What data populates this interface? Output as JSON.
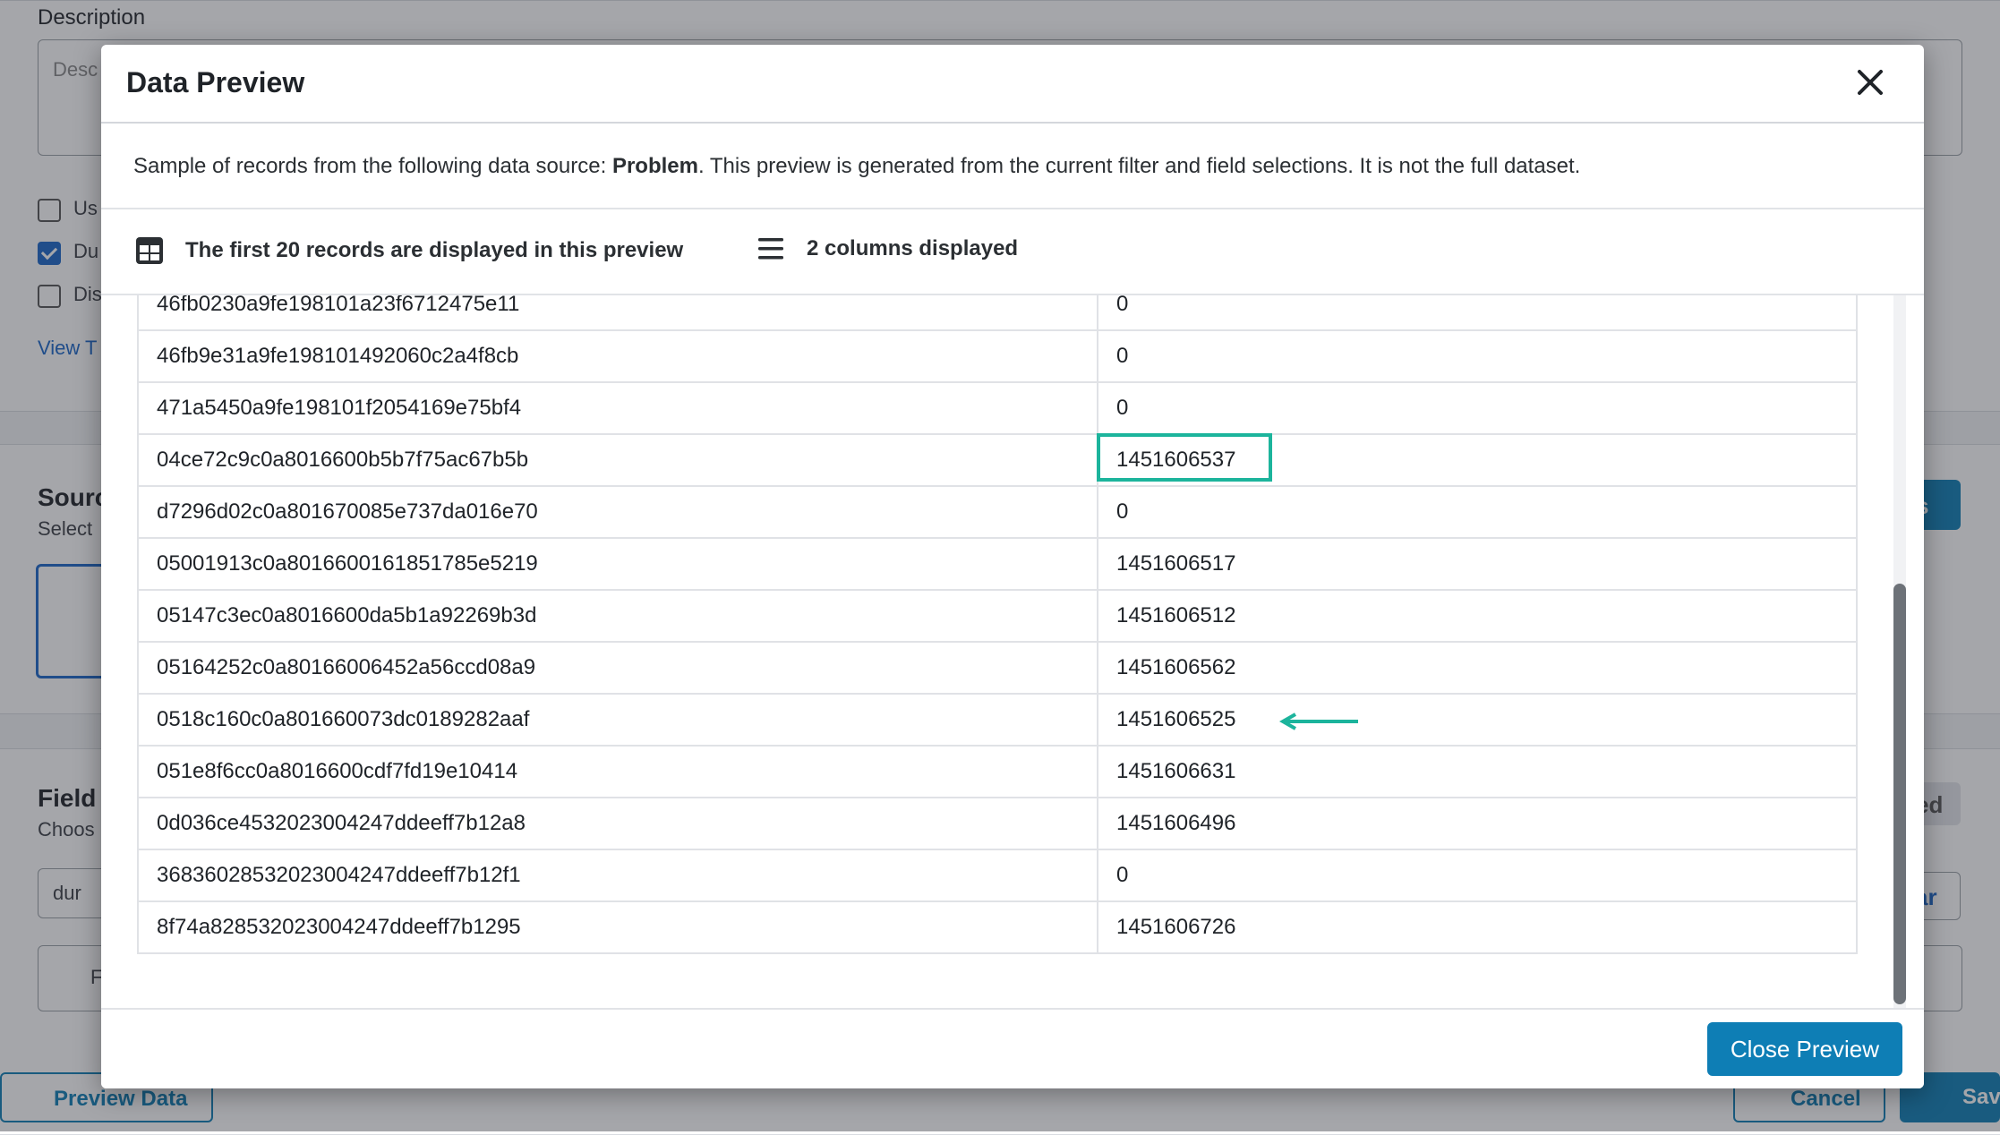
{
  "background": {
    "description_label": "Description",
    "description_placeholder": "Desc",
    "checkbox_labels": [
      "Us",
      "Du",
      "Dis"
    ],
    "view_link": "View T",
    "source_title": "Sourc",
    "source_subtitle": "Select",
    "field_title": "Field",
    "field_subtitle": "Choos",
    "field_search_value": "dur",
    "filter_text": "F",
    "right_button_1": "s",
    "right_button_2": "ed",
    "right_button_3": "ar",
    "preview_data_button": "Preview Data",
    "cancel_button": "Cancel",
    "save_button": "Sav"
  },
  "modal": {
    "title": "Data Preview",
    "description_prefix": "Sample of records from the following data source: ",
    "source_name": "Problem",
    "description_suffix": ". This preview is generated from the current filter and field selections. It is not the full dataset.",
    "records_info": "The first 20 records are displayed in this preview",
    "columns_info": "2 columns displayed",
    "close_button": "Close Preview",
    "highlight_color": "#1cb49c",
    "accent_color": "#0e7eb5",
    "rows": [
      {
        "id": "46fb0230a9fe198101a23f6712475e11",
        "value": "0"
      },
      {
        "id": "46fb9e31a9fe198101492060c2a4f8cb",
        "value": "0"
      },
      {
        "id": "471a5450a9fe198101f2054169e75bf4",
        "value": "0"
      },
      {
        "id": "04ce72c9c0a8016600b5b7f75ac67b5b",
        "value": "1451606537"
      },
      {
        "id": "d7296d02c0a801670085e737da016e70",
        "value": "0"
      },
      {
        "id": "05001913c0a8016600161851785e5219",
        "value": "1451606517"
      },
      {
        "id": "05147c3ec0a8016600da5b1a92269b3d",
        "value": "1451606512"
      },
      {
        "id": "05164252c0a80166006452a56ccd08a9",
        "value": "1451606562"
      },
      {
        "id": "0518c160c0a801660073dc0189282aaf",
        "value": "1451606525"
      },
      {
        "id": "051e8f6cc0a8016600cdf7fd19e10414",
        "value": "1451606631"
      },
      {
        "id": "0d036ce4532023004247ddeeff7b12a8",
        "value": "1451606496"
      },
      {
        "id": "36836028532023004247ddeeff7b12f1",
        "value": "0"
      },
      {
        "id": "8f74a828532023004247ddeeff7b1295",
        "value": "1451606726"
      }
    ]
  }
}
